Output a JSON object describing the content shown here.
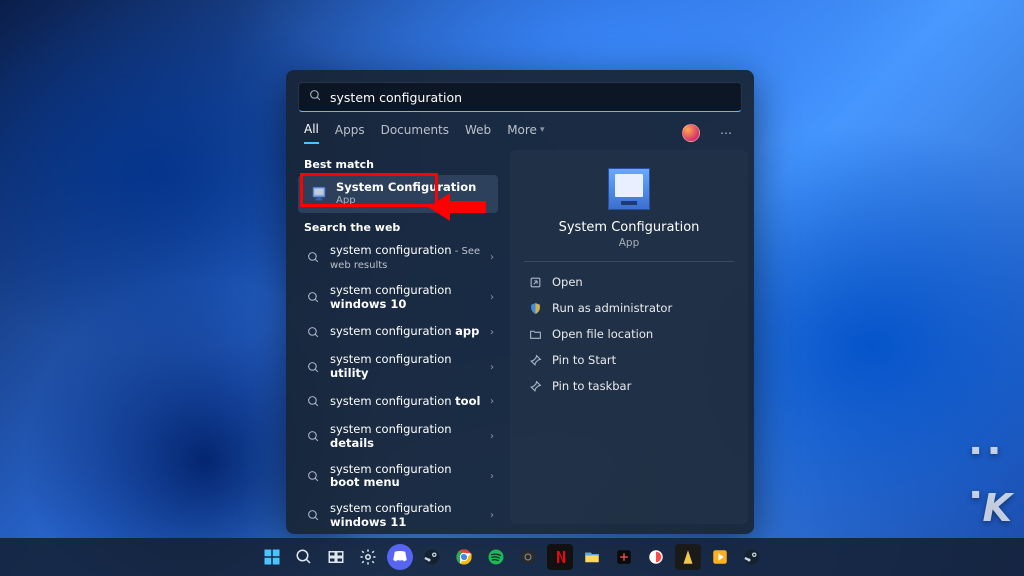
{
  "search": {
    "value": "system configuration"
  },
  "tabs": [
    "All",
    "Apps",
    "Documents",
    "Web",
    "More"
  ],
  "active_tab_index": 0,
  "labels": {
    "best_match": "Best match",
    "search_the_web": "Search the web"
  },
  "best_match": {
    "title": "System Configuration",
    "subtitle": "App"
  },
  "web_results": [
    {
      "prefix": "system configuration",
      "suffix": " - See web results"
    },
    {
      "prefix": "system configuration ",
      "bold": "windows 10"
    },
    {
      "prefix": "system configuration ",
      "bold": "app"
    },
    {
      "prefix": "system configuration ",
      "bold": "utility"
    },
    {
      "prefix": "system configuration ",
      "bold": "tool"
    },
    {
      "prefix": "system configuration ",
      "bold": "details"
    },
    {
      "prefix": "system configuration ",
      "bold": "boot menu"
    },
    {
      "prefix": "system configuration ",
      "bold": "windows 11"
    }
  ],
  "preview": {
    "title": "System Configuration",
    "subtitle": "App",
    "actions": [
      {
        "icon": "open",
        "label": "Open"
      },
      {
        "icon": "admin",
        "label": "Run as administrator"
      },
      {
        "icon": "folder",
        "label": "Open file location"
      },
      {
        "icon": "pin-start",
        "label": "Pin to Start"
      },
      {
        "icon": "pin-taskbar",
        "label": "Pin to taskbar"
      }
    ]
  },
  "watermark": "K"
}
